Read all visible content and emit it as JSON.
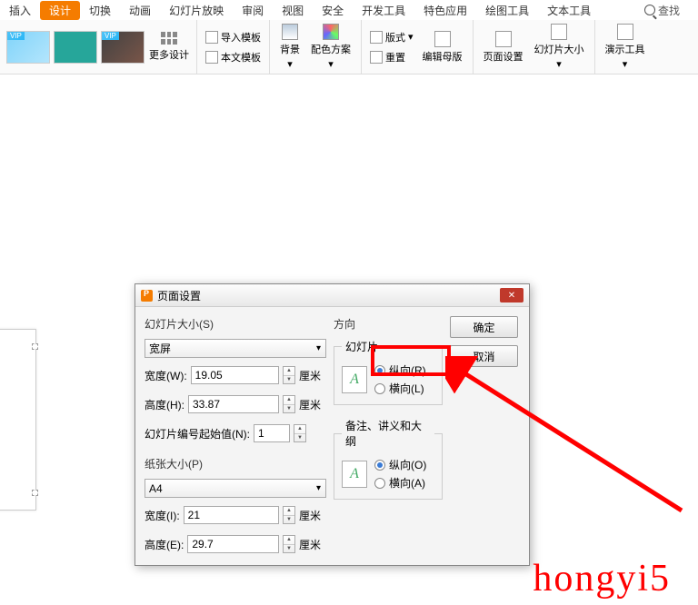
{
  "tabs": {
    "insert": "插入",
    "design": "设计",
    "transition": "切换",
    "animation": "动画",
    "slideshow": "幻灯片放映",
    "review": "审阅",
    "view": "视图",
    "safety": "安全",
    "dev": "开发工具",
    "special": "特色应用",
    "draw": "绘图工具",
    "text": "文本工具",
    "search": "查找"
  },
  "ribbon": {
    "more_design": "更多设计",
    "import_tpl": "导入模板",
    "this_tpl": "本文模板",
    "background": "背景",
    "color_scheme": "配色方案",
    "format": "版式",
    "reset": "重置",
    "edit_master": "编辑母版",
    "page_setup": "页面设置",
    "slide_size": "幻灯片大小",
    "presenter": "演示工具"
  },
  "dialog": {
    "title": "页面设置",
    "slide_size_label": "幻灯片大小(S)",
    "size_value": "宽屏",
    "width_label": "宽度(W):",
    "width_value": "19.05",
    "height_label": "高度(H):",
    "height_value": "33.87",
    "unit_cm": "厘米",
    "start_num_label": "幻灯片编号起始值(N):",
    "start_num_value": "1",
    "paper_size_label": "纸张大小(P)",
    "paper_value": "A4",
    "paper_w_label": "宽度(I):",
    "paper_w_value": "21",
    "paper_h_label": "高度(E):",
    "paper_h_value": "29.7",
    "orientation": "方向",
    "slide_section": "幻灯片",
    "portrait_r": "纵向(R)",
    "landscape_l": "横向(L)",
    "notes_section": "备注、讲义和大纲",
    "portrait_o": "纵向(O)",
    "landscape_a": "横向(A)",
    "ok": "确定",
    "cancel": "取消"
  },
  "watermark": "hongyi5"
}
